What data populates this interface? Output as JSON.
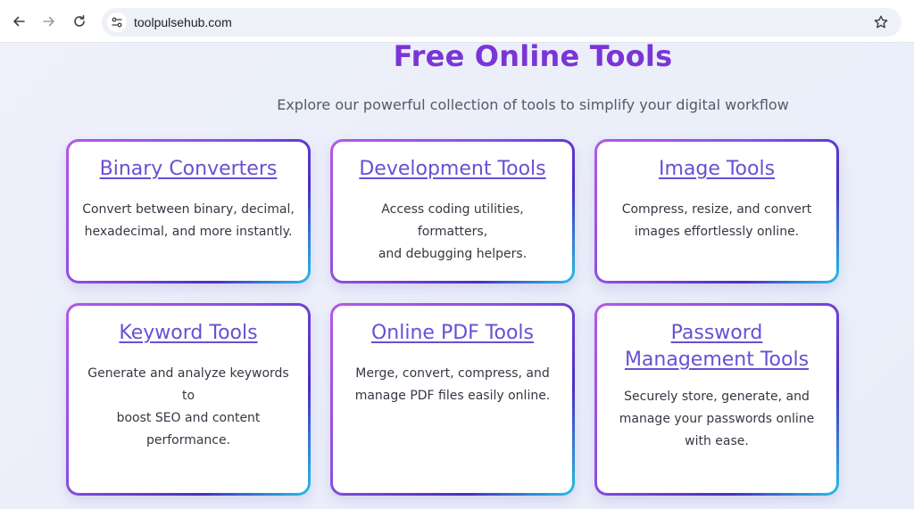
{
  "browser": {
    "url": "toolpulsehub.com",
    "icons": {
      "back": "arrow-left-icon",
      "forward": "arrow-right-icon",
      "reload": "reload-icon",
      "site_info": "tune-icon",
      "bookmark": "star-icon"
    }
  },
  "page": {
    "title": "Free Online Tools",
    "subtitle": "Explore our powerful collection of tools to simplify your digital workflow",
    "accent_color": "#7b35d6",
    "link_color": "#6a4fd4"
  },
  "cards": [
    {
      "title": "Binary Converters",
      "desc_lines": [
        "Convert between binary, decimal,",
        "hexadecimal, and more instantly."
      ]
    },
    {
      "title": "Development Tools",
      "desc_lines": [
        "Access coding utilities, formatters,",
        "and debugging helpers."
      ]
    },
    {
      "title": "Image Tools",
      "desc_lines": [
        "Compress, resize, and convert",
        "images effortlessly online."
      ]
    },
    {
      "title": "Keyword Tools",
      "desc_lines": [
        "Generate and analyze keywords to",
        "boost SEO and content",
        "performance."
      ]
    },
    {
      "title": "Online PDF Tools",
      "desc_lines": [
        "Merge, convert, compress, and",
        "manage PDF files easily online."
      ]
    },
    {
      "title_lines": [
        "Password",
        "Management Tools"
      ],
      "desc_lines": [
        "Securely store, generate, and",
        "manage your passwords online",
        "with ease."
      ]
    }
  ]
}
